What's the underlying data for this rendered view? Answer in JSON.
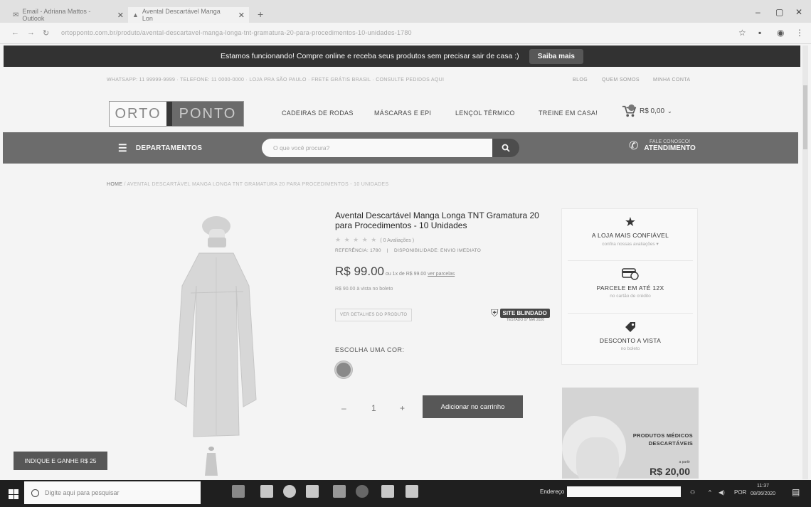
{
  "browser": {
    "tabs": [
      {
        "title": "Email - Adriana Mattos - Outlook",
        "active": false
      },
      {
        "title": "Avental Descartável Manga Lon",
        "active": true
      }
    ],
    "url": "ortopponto.com.br/produto/avental-descartavel-manga-longa-tnt-gramatura-20-para-procedimentos-10-unidades-1780",
    "window": {
      "minimize": "–",
      "restore": "▢",
      "close": "✕"
    }
  },
  "promo": {
    "text": "Estamos funcionando! Compre online e receba seus produtos sem precisar sair de casa :)",
    "button": "Saiba mais"
  },
  "top_info": "WHATSAPP: 11 99999-9999 · TELEFONE: 11 0000-0000 · LOJA PRA SÃO PAULO · FRETE GRÁTIS BRASIL · CONSULTE PEDIDOS AQUI",
  "top_links": [
    "BLOG",
    "QUEM SOMOS",
    "MINHA CONTA"
  ],
  "logo": {
    "left": "ORTO",
    "right": "PONTO"
  },
  "menu": [
    "CADEIRAS DE RODAS",
    "MÁSCARAS E EPI",
    "LENÇOL TÉRMICO",
    "TREINE EM CASA!"
  ],
  "cart": {
    "total": "R$ 0,00"
  },
  "nav": {
    "departments": "DEPARTAMENTOS",
    "search_placeholder": "O que você procura?",
    "contact_top": "FALE CONOSCO!",
    "contact_main": "ATENDIMENTO"
  },
  "breadcrumb": {
    "home": "HOME",
    "current": " / AVENTAL DESCARTÁVEL MANGA LONGA TNT GRAMATURA 20 PARA PROCEDIMENTOS - 10 UNIDADES"
  },
  "product": {
    "title": "Avental Descartável Manga Longa TNT Gramatura 20 para Procedimentos - 10 Unidades",
    "stars": "★ ★ ★ ★ ★",
    "reviews": "( 0 Avaliações )",
    "reference": "REFERÊNCIA: 1780",
    "availability": "DISPONIBILIDADE: ENVIO IMEDIATO",
    "price": "R$ 99.00",
    "installments": " ou 1x de R$ 99.00 ",
    "installments_link": "ver parcelas",
    "cash": "R$ 90.00 à vista no boleto",
    "details_button": "VER DETALHES DO PRODUTO",
    "site_blindado": "SITE BLINDADO",
    "site_blindado_sub": "TESTADO 07 MAI 2020",
    "color_label": "ESCOLHA UMA COR:",
    "qty_minus": "–",
    "qty": "1",
    "qty_plus": "+",
    "add_to_cart": "Adicionar no carrinho"
  },
  "badges": [
    {
      "icon": "star-icon",
      "title": "A LOJA MAIS CONFIÁVEL",
      "sub": "confira nossas avaliações ▾"
    },
    {
      "icon": "card-icon",
      "title": "PARCELE EM ATÉ 12X",
      "sub": "no cartão de crédito"
    },
    {
      "icon": "discount-icon",
      "title": "DESCONTO A VISTA",
      "sub": "no boleto"
    }
  ],
  "banner": {
    "line1": "PRODUTOS MÉDICOS",
    "line2": "DESCARTÁVEIS",
    "small": "a partir",
    "price": "R$ 20,00"
  },
  "indique": "INDIQUE E GANHE R$ 25",
  "taskbar": {
    "search_placeholder": "Digite aqui para pesquisar",
    "endereco": "Endereço",
    "lang": "POR",
    "time": "11:37",
    "date": "08/06/2020"
  }
}
